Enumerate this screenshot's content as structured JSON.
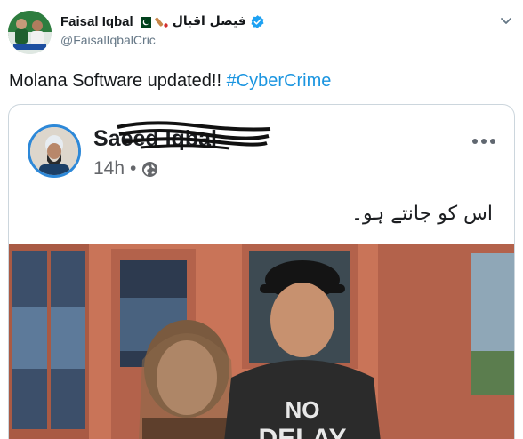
{
  "tweet": {
    "author": {
      "display_name": "Faisal Iqbal",
      "urdu_name": "فیصل اقبال",
      "handle": "@FaisalIqbalCric",
      "verified": true
    },
    "text_plain": "Molana Software updated!! ",
    "hashtag": "#CyberCrime"
  },
  "embedded_post": {
    "poster_name_visible": "Saeed Iqbal",
    "time": "14h",
    "separator": "•",
    "text": "اس کو جانتے ہو۔",
    "more_icon": "ellipsis-icon",
    "privacy_icon": "globe-icon"
  },
  "colors": {
    "accent": "#1b95e0",
    "handle_gray": "#657786",
    "border": "#ccd6dd",
    "fb_avatar_ring": "#2d88d8"
  }
}
